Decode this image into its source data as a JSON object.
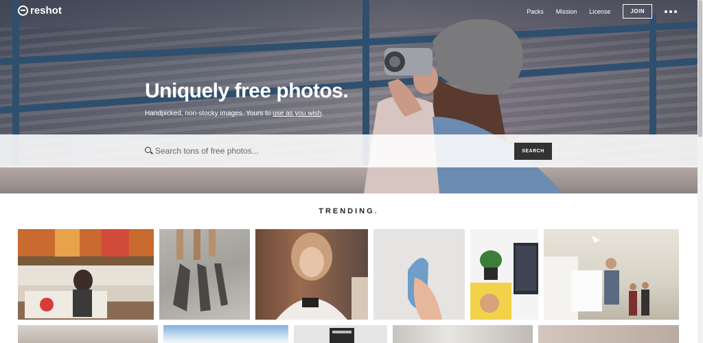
{
  "brand": {
    "name": "reshot"
  },
  "nav": {
    "items": [
      "Packs",
      "Mission",
      "License"
    ],
    "join_label": "JOIN"
  },
  "hero": {
    "headline": "Uniquely free photos.",
    "subtitle_prefix": "Handpicked, non-stocky images. Yours to ",
    "subtitle_link": "use as you wish",
    "subtitle_suffix": "."
  },
  "search": {
    "placeholder": "Search tons of free photos...",
    "button_label": "SEARCH"
  },
  "trending": {
    "title": "TRENDING",
    "accent": "."
  },
  "colors": {
    "accent": "#e53b4a",
    "button_dark": "#333333"
  },
  "photos": [
    "interior-woman-on-couch",
    "shadows-on-ground",
    "woman-using-phone",
    "hand-holding-bird-figure",
    "desk-with-magazine-and-laptop",
    "office-people",
    "row2-photo-1",
    "row2-photo-2",
    "row2-photo-3",
    "row2-photo-4",
    "row2-photo-5"
  ]
}
